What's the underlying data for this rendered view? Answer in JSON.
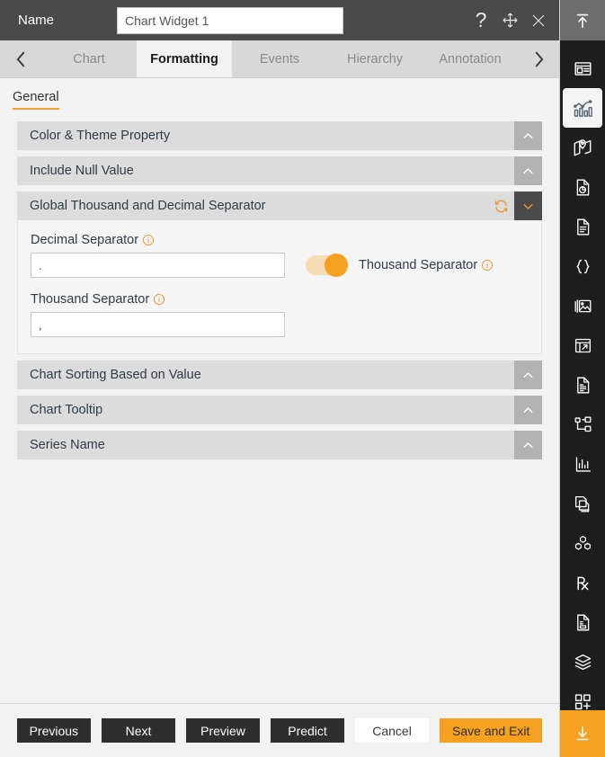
{
  "titlebar": {
    "label": "Name",
    "name_value": "Chart Widget 1",
    "name_placeholder": "Chart Widget 1",
    "help_icon": "question-mark-icon",
    "move_icon": "move-icon",
    "close_icon": "close-icon"
  },
  "tabstrip": {
    "prev_icon": "chevron-left-icon",
    "next_icon": "chevron-right-icon",
    "tabs": [
      {
        "label": "Chart",
        "active": false
      },
      {
        "label": "Formatting",
        "active": true
      },
      {
        "label": "Events",
        "active": false
      },
      {
        "label": "Hierarchy",
        "active": false
      },
      {
        "label": "Annotation",
        "active": false
      }
    ]
  },
  "subtabs": {
    "items": [
      {
        "label": "General",
        "active": true
      }
    ]
  },
  "sections": [
    {
      "title": "Color & Theme Property",
      "expanded": false,
      "chevron": "chevron-up-icon"
    },
    {
      "title": "Include Null Value",
      "expanded": false,
      "chevron": "chevron-up-icon"
    },
    {
      "title": "Global Thousand and Decimal Separator",
      "expanded": true,
      "chevron": "chevron-down-icon",
      "refresh_icon": "refresh-icon"
    },
    {
      "title": "Chart Sorting Based on Value",
      "expanded": false,
      "chevron": "chevron-up-icon"
    },
    {
      "title": "Chart Tooltip",
      "expanded": false,
      "chevron": "chevron-up-icon"
    },
    {
      "title": "Series Name",
      "expanded": false,
      "chevron": "chevron-up-icon"
    }
  ],
  "separator_panel": {
    "decimal_label": "Decimal Separator",
    "decimal_value": ".",
    "decimal_placeholder": ".",
    "thousand_label": "Thousand Separator",
    "thousand_value": ",",
    "thousand_placeholder": ",",
    "toggle_label": "Thousand Separator",
    "toggle_on": true,
    "info_icon": "info-icon"
  },
  "footer": {
    "buttons": [
      {
        "label": "Previous",
        "style": "dark"
      },
      {
        "label": "Next",
        "style": "dark"
      },
      {
        "label": "Preview",
        "style": "dark"
      },
      {
        "label": "Predict",
        "style": "dark"
      },
      {
        "label": "Cancel",
        "style": "light"
      },
      {
        "label": "Save and Exit",
        "style": "accent"
      }
    ]
  },
  "rail": {
    "top_icon": "collapse-up-icon",
    "bottom_icon": "expand-down-icon",
    "items": [
      {
        "icon": "card-layout-icon",
        "active": false
      },
      {
        "icon": "chart-icon",
        "active": true
      },
      {
        "icon": "map-icon",
        "active": false
      },
      {
        "icon": "document-pie-chart-icon",
        "active": false
      },
      {
        "icon": "document-icon",
        "active": false
      },
      {
        "icon": "code-braces-icon",
        "active": false
      },
      {
        "icon": "image-gallery-icon",
        "active": false
      },
      {
        "icon": "table-grid-icon",
        "active": false
      },
      {
        "icon": "report-icon",
        "active": false
      },
      {
        "icon": "hierarchy-tree-icon",
        "active": false
      },
      {
        "icon": "bar-chart-icon",
        "active": false
      },
      {
        "icon": "copy-document-icon",
        "active": false
      },
      {
        "icon": "cubes-icon",
        "active": false
      },
      {
        "icon": "prescription-rx-icon",
        "active": false
      },
      {
        "icon": "form-document-icon",
        "active": false
      },
      {
        "icon": "layers-icon",
        "active": false
      },
      {
        "icon": "add-widget-icon",
        "active": false
      }
    ]
  },
  "colors": {
    "accent": "#f5a01e",
    "titlebar_bg": "#4a4a4a",
    "rail_bg": "#1e1e1e",
    "section_header_bg": "#dcdcdc",
    "body_bg": "#f2f2f2"
  }
}
